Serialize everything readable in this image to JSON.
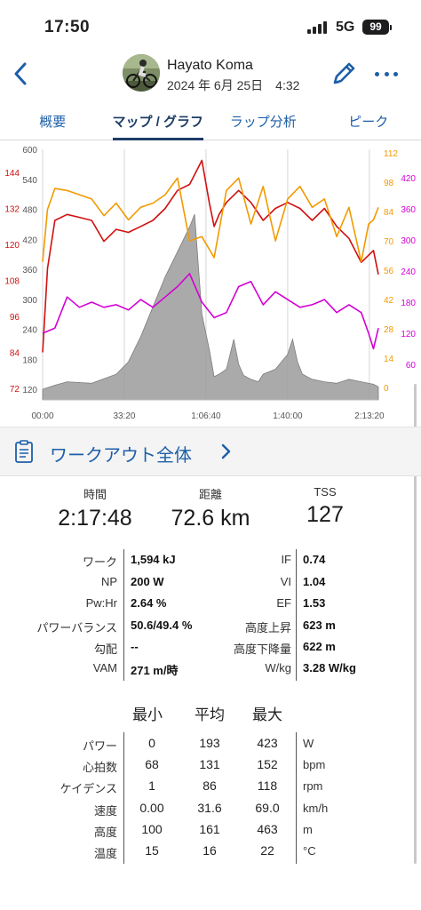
{
  "status_bar": {
    "time": "17:50",
    "network": "5G",
    "battery": "99"
  },
  "header": {
    "user_name": "Hayato Koma",
    "date": "2024 年 6月 25日　4:32",
    "back_icon": "chevron-left-icon",
    "edit_icon": "pencil-icon",
    "more_icon": "more-dots-icon"
  },
  "tabs": [
    {
      "label": "概要",
      "active": false
    },
    {
      "label": "マップ / グラフ",
      "active": true
    },
    {
      "label": "ラップ分析",
      "active": false
    },
    {
      "label": "ピーク",
      "active": false
    }
  ],
  "chart_data": {
    "type": "line",
    "x_ticks": [
      "00:00",
      "33:20",
      "1:06:40",
      "1:40:00",
      "2:13:20"
    ],
    "axes": {
      "hr_left": {
        "ticks": [
          "144",
          "132",
          "120",
          "108",
          "96",
          "84",
          "72"
        ],
        "color": "#d01010"
      },
      "power_left": {
        "ticks": [
          "600",
          "540",
          "480",
          "420",
          "360",
          "300",
          "240",
          "180",
          "120"
        ],
        "color": "#555555"
      },
      "cadence_right": {
        "ticks": [
          "112",
          "98",
          "84",
          "70",
          "56",
          "42",
          "28",
          "14",
          "0"
        ],
        "color": "#f29a00"
      },
      "speed_right": {
        "ticks": [
          "420",
          "360",
          "300",
          "240",
          "180",
          "120",
          "60"
        ],
        "color": "#d400d4"
      }
    },
    "series": [
      {
        "color": "#d01010",
        "axis": "hr_left",
        "x": [
          0,
          2,
          5,
          10,
          15,
          20,
          25,
          30,
          35,
          40,
          45,
          50,
          55,
          60,
          65,
          68,
          70,
          72,
          75,
          80,
          85,
          90,
          95,
          100,
          105,
          110,
          115,
          120,
          125,
          130,
          135,
          137
        ],
        "values": [
          84,
          112,
          128,
          130,
          129,
          128,
          121,
          125,
          124,
          126,
          128,
          132,
          138,
          140,
          148,
          134,
          126,
          130,
          134,
          138,
          134,
          128,
          132,
          134,
          132,
          128,
          132,
          126,
          122,
          114,
          118,
          110
        ]
      },
      {
        "color": "#f29a00",
        "axis": "cadence_right",
        "x": [
          0,
          2,
          5,
          10,
          15,
          20,
          25,
          30,
          35,
          40,
          45,
          50,
          55,
          60,
          65,
          70,
          75,
          80,
          85,
          90,
          95,
          100,
          105,
          110,
          115,
          120,
          125,
          130,
          133,
          135,
          137
        ],
        "values": [
          60,
          85,
          95,
          94,
          92,
          90,
          82,
          88,
          80,
          86,
          88,
          92,
          100,
          70,
          72,
          62,
          94,
          100,
          78,
          96,
          70,
          90,
          96,
          86,
          90,
          72,
          86,
          60,
          78,
          80,
          86
        ]
      },
      {
        "color": "#d400d4",
        "axis": "speed_right",
        "x": [
          0,
          5,
          10,
          15,
          20,
          25,
          30,
          35,
          40,
          45,
          50,
          55,
          60,
          65,
          70,
          75,
          80,
          85,
          90,
          95,
          100,
          105,
          110,
          115,
          120,
          125,
          130,
          133,
          135,
          137
        ],
        "values": [
          120,
          130,
          190,
          170,
          180,
          170,
          175,
          165,
          185,
          170,
          190,
          210,
          235,
          180,
          150,
          160,
          210,
          220,
          175,
          200,
          185,
          170,
          175,
          185,
          160,
          175,
          160,
          120,
          90,
          130
        ]
      },
      {
        "color": "#9b9b9b",
        "axis": "power_left",
        "fill": true,
        "x": [
          0,
          5,
          10,
          20,
          30,
          35,
          40,
          45,
          50,
          55,
          60,
          62,
          65,
          68,
          70,
          72,
          75,
          78,
          80,
          82,
          85,
          88,
          90,
          95,
          100,
          102,
          104,
          106,
          110,
          115,
          120,
          125,
          130,
          135,
          137
        ],
        "values": [
          120,
          128,
          135,
          132,
          150,
          175,
          225,
          285,
          345,
          395,
          445,
          470,
          270,
          200,
          145,
          150,
          160,
          220,
          170,
          148,
          140,
          135,
          150,
          160,
          190,
          220,
          175,
          150,
          140,
          135,
          132,
          140,
          135,
          130,
          125
        ]
      }
    ]
  },
  "workout_summary": {
    "label": "ワークアウト全体",
    "icon": "clipboard-icon"
  },
  "main_metrics": [
    {
      "label": "時間",
      "value": "2:17:48"
    },
    {
      "label": "距離",
      "value": "72.6 km"
    },
    {
      "label": "TSS",
      "value": "127"
    }
  ],
  "stats": [
    {
      "label1": "ワーク",
      "value1": "1,594 kJ",
      "label2": "IF",
      "value2": "0.74"
    },
    {
      "label1": "NP",
      "value1": "200 W",
      "label2": "VI",
      "value2": "1.04"
    },
    {
      "label1": "Pw:Hr",
      "value1": "2.64 %",
      "label2": "EF",
      "value2": "1.53"
    },
    {
      "label1": "パワーバランス",
      "value1": "50.6/49.4 %",
      "label2": "高度上昇",
      "value2": "623 m"
    },
    {
      "label1": "勾配",
      "value1": "--",
      "label2": "高度下降量",
      "value2": "622 m"
    },
    {
      "label1": "VAM",
      "value1": "271 m/時",
      "label2": "W/kg",
      "value2": "3.28 W/kg"
    }
  ],
  "min_avg_max": {
    "headers": [
      "最小",
      "平均",
      "最大"
    ],
    "rows": [
      {
        "label": "パワー",
        "min": "0",
        "avg": "193",
        "max": "423",
        "unit": "W"
      },
      {
        "label": "心拍数",
        "min": "68",
        "avg": "131",
        "max": "152",
        "unit": "bpm"
      },
      {
        "label": "ケイデンス",
        "min": "1",
        "avg": "86",
        "max": "118",
        "unit": "rpm"
      },
      {
        "label": "速度",
        "min": "0.00",
        "avg": "31.6",
        "max": "69.0",
        "unit": "km/h"
      },
      {
        "label": "高度",
        "min": "100",
        "avg": "161",
        "max": "463",
        "unit": "m"
      },
      {
        "label": "温度",
        "min": "15",
        "avg": "16",
        "max": "22",
        "unit": "°C"
      }
    ]
  }
}
